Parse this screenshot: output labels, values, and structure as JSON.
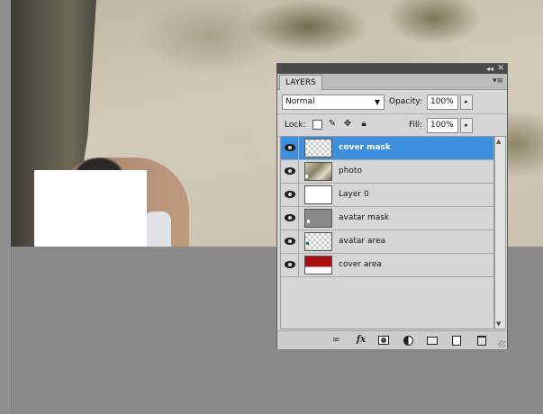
{
  "panel": {
    "tab_label": "LAYERS",
    "collapse_glyph": "◂◂",
    "close_glyph": "✕",
    "menu_glyph": "▾≡"
  },
  "blend": {
    "mode": "Normal",
    "arrow_glyph": "▼"
  },
  "opacity": {
    "label": "Opacity:",
    "value": "100%",
    "arrow_glyph": "▸"
  },
  "lock": {
    "label": "Lock:"
  },
  "fill": {
    "label": "Fill:",
    "value": "100%",
    "arrow_glyph": "▸"
  },
  "layers": [
    {
      "name": "cover mask",
      "selected": true,
      "thumb": "checker"
    },
    {
      "name": "photo",
      "selected": false,
      "thumb": "photo"
    },
    {
      "name": "Layer 0",
      "selected": false,
      "thumb": "white"
    },
    {
      "name": "avatar mask",
      "selected": false,
      "thumb": "gray"
    },
    {
      "name": "avatar area",
      "selected": false,
      "thumb": "checker"
    },
    {
      "name": "cover area",
      "selected": false,
      "thumb": "red"
    }
  ],
  "bottom_toolbar": {
    "link_glyph": "∞",
    "fx_label": "fx"
  },
  "scroll": {
    "up_glyph": "▲",
    "down_glyph": "▼"
  },
  "colors": {
    "selection": "#3c8fdf",
    "cover_area_red": "#a80f0f",
    "panel_bg": "#d6d6d6",
    "workspace": "#898989"
  }
}
